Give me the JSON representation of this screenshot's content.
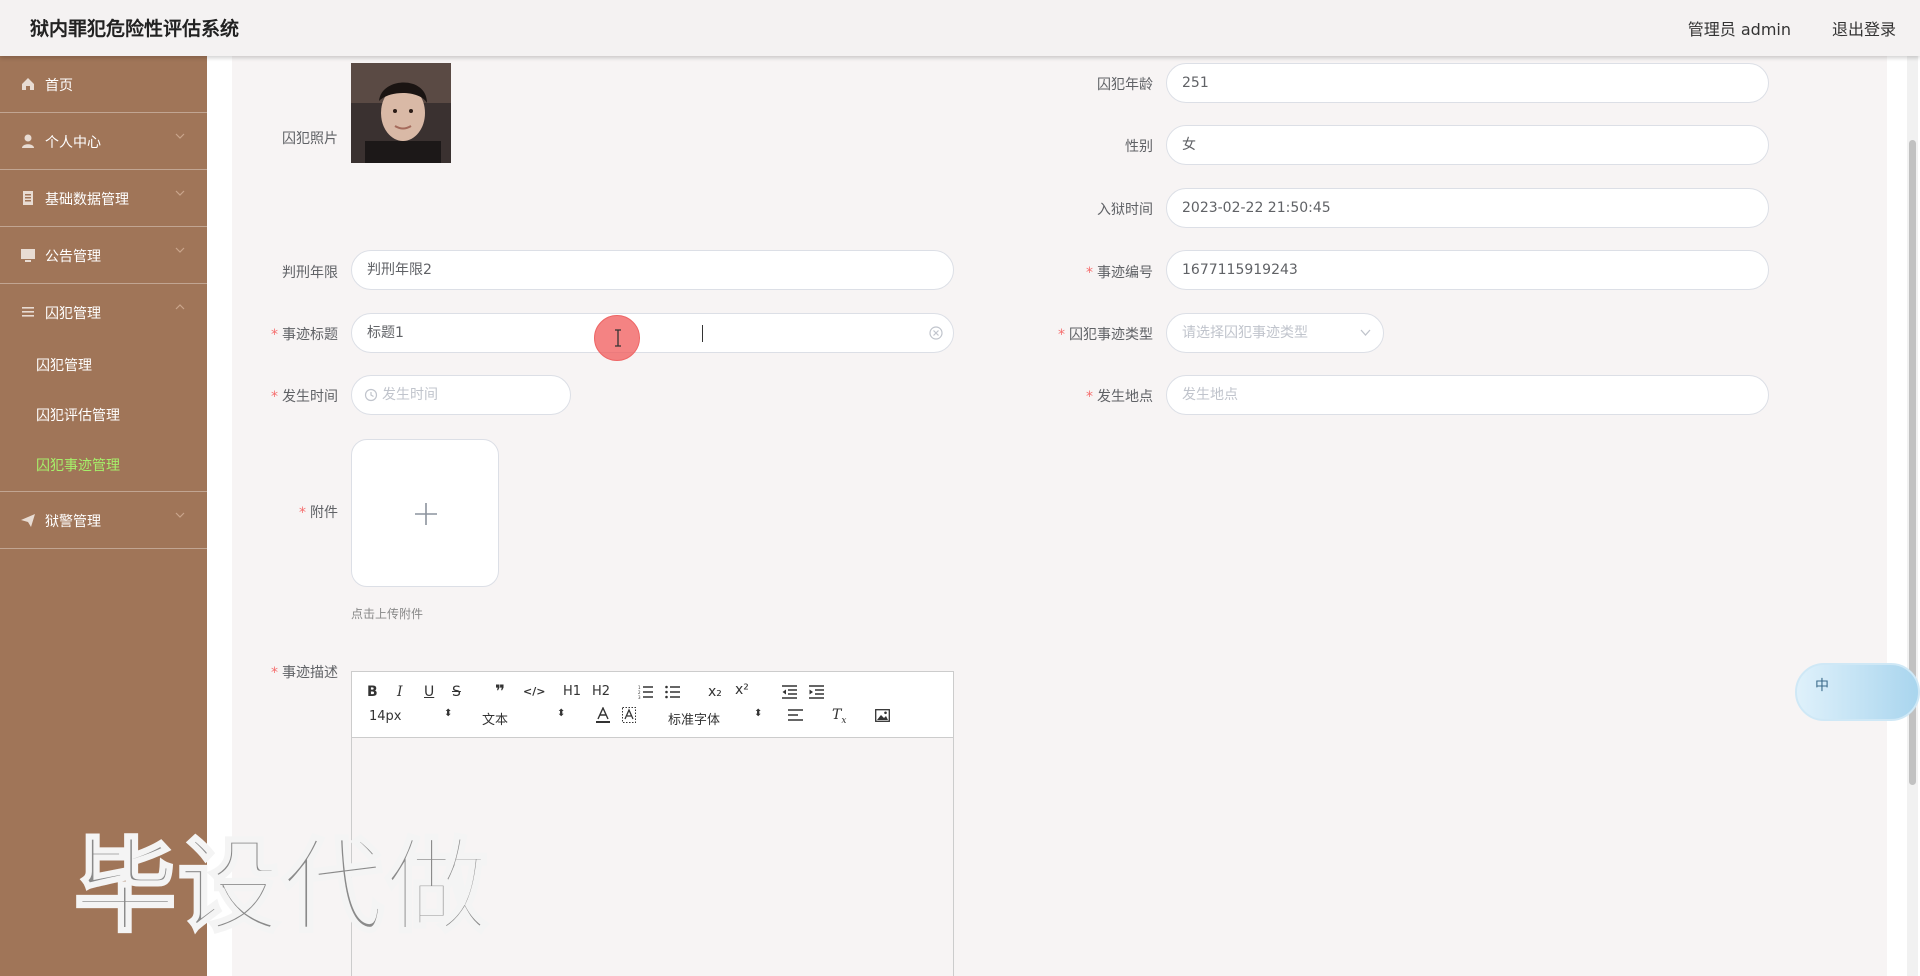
{
  "app": {
    "title": "狱内罪犯危险性评估系统"
  },
  "header": {
    "user_label": "管理员 admin",
    "logout_label": "退出登录"
  },
  "sidebar": {
    "items": [
      {
        "label": "首页",
        "icon": "home-icon"
      },
      {
        "label": "个人中心",
        "icon": "user-icon"
      },
      {
        "label": "基础数据管理",
        "icon": "document-icon"
      },
      {
        "label": "公告管理",
        "icon": "monitor-icon"
      },
      {
        "label": "囚犯管理",
        "icon": "menu-icon",
        "children": [
          "囚犯管理",
          "囚犯评估管理",
          "囚犯事迹管理"
        ],
        "active_child": "囚犯事迹管理"
      },
      {
        "label": "狱警管理",
        "icon": "send-icon"
      }
    ]
  },
  "form": {
    "photo_label": "囚犯照片",
    "age_label": "囚犯年龄",
    "age_value": "251",
    "gender_label": "性别",
    "gender_value": "女",
    "entry_time_label": "入狱时间",
    "entry_time_value": "2023-02-22 21:50:45",
    "sentence_label": "判刑年限",
    "sentence_value": "判刑年限2",
    "event_no_label": "事迹编号",
    "event_no_value": "1677115919243",
    "event_title_label": "事迹标题",
    "event_title_value": "标题1",
    "event_type_label": "囚犯事迹类型",
    "event_type_placeholder": "请选择囚犯事迹类型",
    "occur_time_label": "发生时间",
    "occur_time_placeholder": "发生时间",
    "occur_place_label": "发生地点",
    "occur_place_placeholder": "发生地点",
    "attachment_label": "附件",
    "upload_tip": "点击上传附件",
    "description_label": "事迹描述"
  },
  "editor": {
    "font_size": "14px",
    "block_type": "文本",
    "font_family": "标准字体",
    "buttons": {
      "bold": "B",
      "italic": "I",
      "underline": "U",
      "strike": "S",
      "quote": "❞",
      "code": "</>",
      "h1": "H1",
      "h2": "H2",
      "sub": "x₂",
      "sup": "x²"
    }
  },
  "watermark": {
    "text": "毕设代做"
  },
  "ime": {
    "text": "中"
  },
  "colors": {
    "sidebar": "#a07558",
    "active": "#a6f06a",
    "required": "#f56c6c"
  }
}
